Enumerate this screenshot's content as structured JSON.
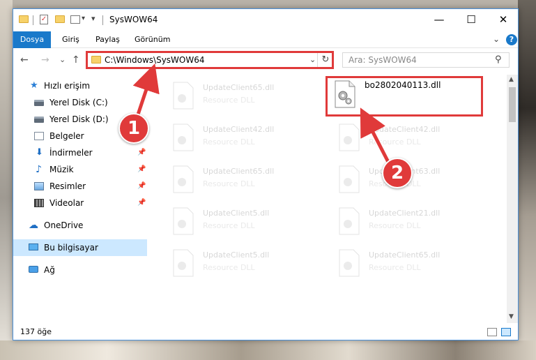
{
  "window": {
    "title": "SysWOW64",
    "minimize": "—",
    "maximize": "☐",
    "close": "✕"
  },
  "quick_access_toolbar": {
    "dropdown_glyph": "▾",
    "check_glyph": "✓"
  },
  "ribbon": {
    "tabs": [
      {
        "label": "Dosya",
        "active": true
      },
      {
        "label": "Giriş"
      },
      {
        "label": "Paylaş"
      },
      {
        "label": "Görünüm"
      }
    ],
    "collapse_glyph": "⌄",
    "help_glyph": "?"
  },
  "navigation": {
    "back_glyph": "←",
    "forward_glyph": "→",
    "recent_glyph": "⌄",
    "up_glyph": "↑",
    "address": "C:\\Windows\\SysWOW64",
    "address_dropdown_glyph": "⌄",
    "refresh_glyph": "↻",
    "search_placeholder": "Ara: SysWOW64",
    "search_glyph": "⚲"
  },
  "sidebar": {
    "items": [
      {
        "label": "Hızlı erişim",
        "icon": "star-icon"
      },
      {
        "label": "Yerel Disk (C:)",
        "icon": "drive-icon"
      },
      {
        "label": "Yerel Disk (D:)",
        "icon": "drive-icon"
      },
      {
        "label": "Belgeler",
        "icon": "documents-icon"
      },
      {
        "label": "İndirmeler",
        "icon": "download-icon",
        "pinned": true
      },
      {
        "label": "Müzik",
        "icon": "music-icon",
        "pinned": true
      },
      {
        "label": "Resimler",
        "icon": "pictures-icon",
        "pinned": true
      },
      {
        "label": "Videolar",
        "icon": "videos-icon",
        "pinned": true
      },
      {
        "label": "OneDrive",
        "icon": "cloud-icon"
      },
      {
        "label": "Bu bilgisayar",
        "icon": "computer-icon",
        "selected": true
      },
      {
        "label": "Ağ",
        "icon": "network-icon"
      }
    ],
    "pin_glyph": "📌",
    "star_glyph": "★",
    "download_glyph": "⬇",
    "music_glyph": "♪",
    "cloud_glyph": "☁"
  },
  "files": {
    "highlighted": {
      "name": "bo2802040113.dll",
      "description": ""
    },
    "background_tiles": [
      {
        "name": "UpdateClient65.dll",
        "description": "Resource DLL"
      },
      {
        "name": "UpdateClient42.dll",
        "description": "Resource DLL"
      },
      {
        "name": "UpdateClient42.dll",
        "description": "Resource DLL"
      },
      {
        "name": "UpdateClient65.dll",
        "description": "Resource DLL"
      },
      {
        "name": "UpdateClient63.dll",
        "description": "Resource DLL"
      },
      {
        "name": "UpdateClient5.dll",
        "description": "Resource DLL"
      },
      {
        "name": "UpdateClient21.dll",
        "description": "Resource DLL"
      },
      {
        "name": "UpdateClient5.dll",
        "description": "Resource DLL"
      },
      {
        "name": "UpdateClient65.dll",
        "description": "Resource DLL"
      }
    ]
  },
  "scrollbar": {
    "up_glyph": "▲",
    "down_glyph": "▼"
  },
  "status": {
    "item_count": "137 öğe"
  },
  "callouts": {
    "first": "1",
    "second": "2",
    "color": "#e03a3a"
  },
  "colors": {
    "accent": "#1979ca",
    "highlight": "#e03a3a",
    "selection": "#cce8ff"
  }
}
